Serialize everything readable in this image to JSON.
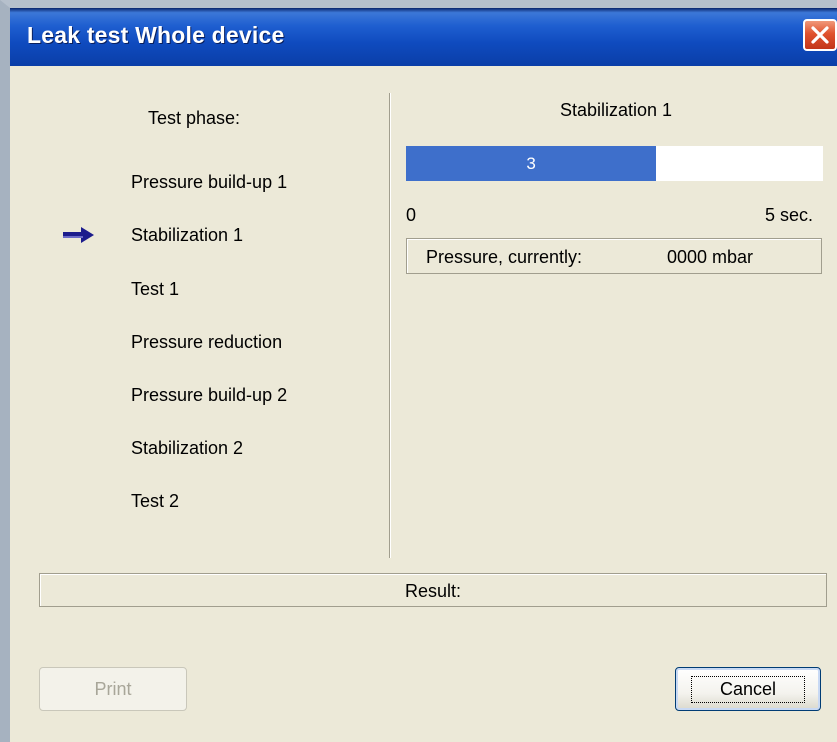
{
  "window": {
    "title": "Leak test Whole device"
  },
  "phases": {
    "heading": "Test phase:",
    "current_index": 1,
    "items": [
      {
        "label": "Pressure build-up 1"
      },
      {
        "label": "Stabilization 1"
      },
      {
        "label": "Test 1"
      },
      {
        "label": "Pressure reduction"
      },
      {
        "label": "Pressure build-up 2"
      },
      {
        "label": "Stabilization 2"
      },
      {
        "label": "Test 2"
      }
    ]
  },
  "status": {
    "current_phase": "Stabilization 1",
    "progress": {
      "value": "3",
      "fraction": 0.6,
      "min_label": "0",
      "max_label": "5 sec."
    },
    "pressure_label": "Pressure, currently:",
    "pressure_value": "0000 mbar"
  },
  "result": {
    "label": "Result:"
  },
  "buttons": {
    "print": "Print",
    "cancel": "Cancel"
  },
  "colors": {
    "accent": "#3e6fcb",
    "arrow": "#1c1c8c"
  }
}
